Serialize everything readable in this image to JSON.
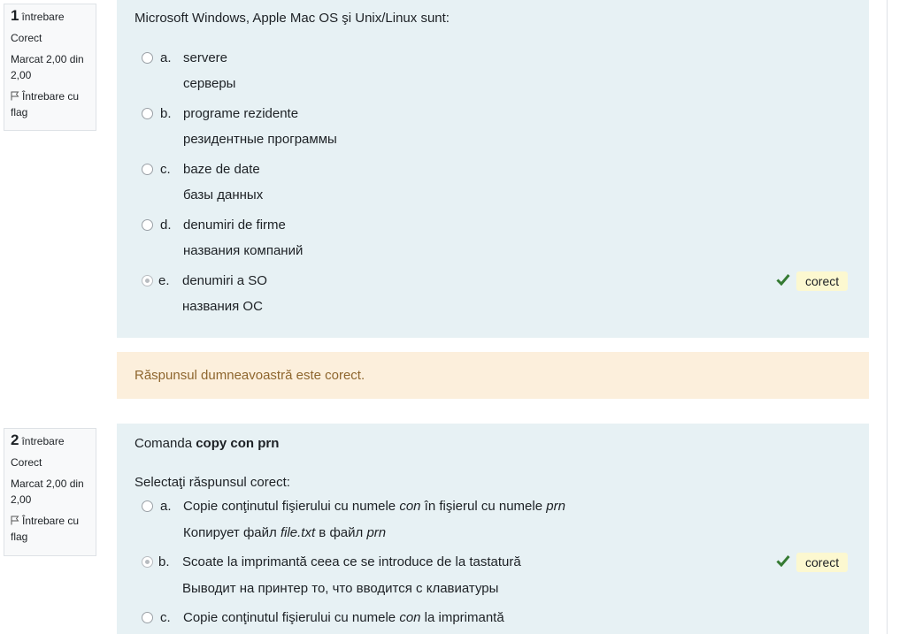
{
  "q1": {
    "number": "1",
    "number_label": "întrebare",
    "state": "Corect",
    "grade": "Marcat 2,00 din 2,00",
    "flag_label": "Întrebare cu flag",
    "text": "Microsoft Windows, Apple Mac OS şi Unix/Linux sunt:",
    "answers": [
      {
        "letter": "a.",
        "text": "servere",
        "translation": "серверы"
      },
      {
        "letter": "b.",
        "text": "programe rezidente",
        "translation": "резидентные программы"
      },
      {
        "letter": "c.",
        "text": "baze de date",
        "translation": "базы данных"
      },
      {
        "letter": "d.",
        "text": "denumiri de firme",
        "translation": "названия компаний"
      },
      {
        "letter": "e.",
        "text": "denumiri a SO",
        "translation": "названия ОС",
        "selected": true,
        "badge": "corect"
      }
    ],
    "feedback": "Răspunsul dumneavoastră este corect."
  },
  "q2": {
    "number": "2",
    "number_label": "întrebare",
    "state": "Corect",
    "grade": "Marcat 2,00 din 2,00",
    "flag_label": "Întrebare cu flag",
    "text_prefix": "Comanda ",
    "text_bold": "copy con prn",
    "prompt": "Selectaţi răspunsul corect:",
    "answers": [
      {
        "letter": "a.",
        "text_1": "Copie conţinutul fişierului cu numele ",
        "text_2": "con",
        "text_3": " în fişierul cu numele ",
        "text_4": "prn",
        "tr_1": "Копирует файл ",
        "tr_2": "file.txt",
        "tr_3": " в файл ",
        "tr_4": "prn"
      },
      {
        "letter": "b.",
        "text": "Scoate la imprimantă ceea ce se introduce de la tastatură",
        "translation": "Выводит на принтер то, что вводится с клавиатуры",
        "selected": true,
        "badge": "corect"
      },
      {
        "letter": "c.",
        "text_1": "Copie conţinutul fişierului cu numele ",
        "text_2": "con",
        "text_3": " la imprimantă"
      }
    ]
  },
  "colors": {
    "formulation_bg": "#e7f1f4",
    "feedback_bg": "#fcefdc",
    "feedback_text": "#8e662e",
    "badge_bg": "#fcf8d0",
    "tick": "#357a32"
  },
  "icons": {
    "flag": "flag-outline-icon",
    "correct": "check-icon"
  }
}
